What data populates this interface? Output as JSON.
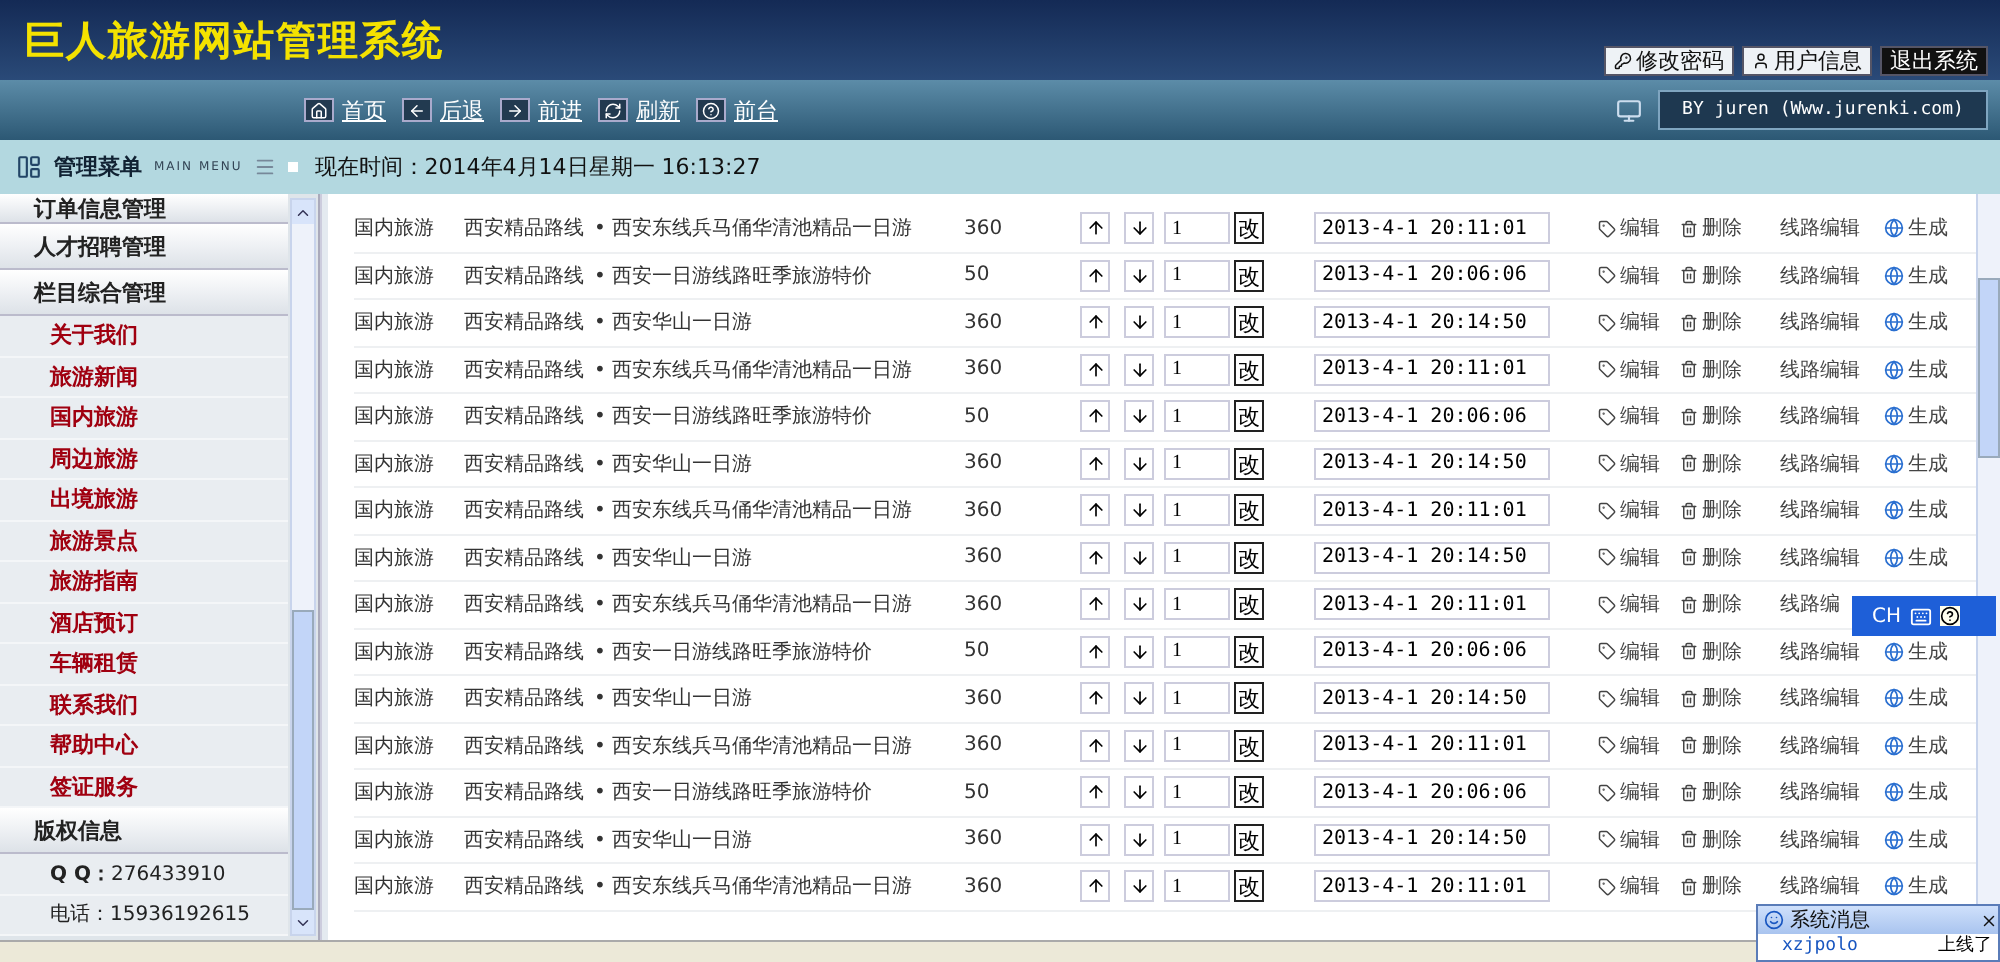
{
  "app_title": "巨人旅游网站管理系统",
  "top_buttons": [
    {
      "label": "修改密码",
      "kind": "key"
    },
    {
      "label": "用户信息",
      "kind": "user"
    },
    {
      "label": "退出系统",
      "kind": "exit"
    }
  ],
  "nav": [
    {
      "label": "首页",
      "kind": "home"
    },
    {
      "label": "后退",
      "kind": "back"
    },
    {
      "label": "前进",
      "kind": "forward"
    },
    {
      "label": "刷新",
      "kind": "refresh"
    },
    {
      "label": "前台",
      "kind": "help"
    }
  ],
  "credit": "BY juren (Www.jurenki.com)",
  "menu_title": "管理菜单",
  "menu_subtitle": "MAIN MENU",
  "clock": "现在时间：2014年4月14日星期一  16:13:27",
  "sidebar": [
    {
      "title": "订单信息管理",
      "kind": "links"
    },
    {
      "title": "人才招聘管理",
      "kind": "links"
    },
    {
      "title": "栏目综合管理",
      "kind": "links",
      "items": [
        "关于我们",
        "旅游新闻",
        "国内旅游",
        "周边旅游",
        "出境旅游",
        "旅游景点",
        "旅游指南",
        "酒店预订",
        "车辆租赁",
        "联系我们",
        "帮助中心",
        "签证服务"
      ]
    },
    {
      "title": "版权信息",
      "kind": "info",
      "items": [
        "**Q Q：**276433910",
        "电话：15936192615"
      ]
    }
  ],
  "rows": [
    {
      "category": "国内旅游",
      "line": "西安精品路线",
      "title": "• 西安东线兵马俑华清池精品一日游",
      "count": "360",
      "order": "1",
      "apply": "改",
      "time": "2013-4-1 20:11:01",
      "edit": "编辑",
      "delete": "删除",
      "route": "线路编辑",
      "generate": "生成"
    },
    {
      "category": "国内旅游",
      "line": "西安精品路线",
      "title": "• 西安一日游线路旺季旅游特价",
      "count": "50",
      "order": "1",
      "apply": "改",
      "time": "2013-4-1 20:06:06",
      "edit": "编辑",
      "delete": "删除",
      "route": "线路编辑",
      "generate": "生成"
    },
    {
      "category": "国内旅游",
      "line": "西安精品路线",
      "title": "• 西安华山一日游",
      "count": "360",
      "order": "1",
      "apply": "改",
      "time": "2013-4-1 20:14:50",
      "edit": "编辑",
      "delete": "删除",
      "route": "线路编辑",
      "generate": "生成"
    },
    {
      "category": "国内旅游",
      "line": "西安精品路线",
      "title": "• 西安东线兵马俑华清池精品一日游",
      "count": "360",
      "order": "1",
      "apply": "改",
      "time": "2013-4-1 20:11:01",
      "edit": "编辑",
      "delete": "删除",
      "route": "线路编辑",
      "generate": "生成"
    },
    {
      "category": "国内旅游",
      "line": "西安精品路线",
      "title": "• 西安一日游线路旺季旅游特价",
      "count": "50",
      "order": "1",
      "apply": "改",
      "time": "2013-4-1 20:06:06",
      "edit": "编辑",
      "delete": "删除",
      "route": "线路编辑",
      "generate": "生成"
    },
    {
      "category": "国内旅游",
      "line": "西安精品路线",
      "title": "• 西安华山一日游",
      "count": "360",
      "order": "1",
      "apply": "改",
      "time": "2013-4-1 20:14:50",
      "edit": "编辑",
      "delete": "删除",
      "route": "线路编辑",
      "generate": "生成"
    },
    {
      "category": "国内旅游",
      "line": "西安精品路线",
      "title": "• 西安东线兵马俑华清池精品一日游",
      "count": "360",
      "order": "1",
      "apply": "改",
      "time": "2013-4-1 20:11:01",
      "edit": "编辑",
      "delete": "删除",
      "route": "线路编辑",
      "generate": "生成"
    },
    {
      "category": "国内旅游",
      "line": "西安精品路线",
      "title": "• 西安华山一日游",
      "count": "360",
      "order": "1",
      "apply": "改",
      "time": "2013-4-1 20:14:50",
      "edit": "编辑",
      "delete": "删除",
      "route": "线路编辑",
      "generate": "生成"
    },
    {
      "category": "国内旅游",
      "line": "西安精品路线",
      "title": "• 西安东线兵马俑华清池精品一日游",
      "count": "360",
      "order": "1",
      "apply": "改",
      "time": "2013-4-1 20:11:01",
      "edit": "编辑",
      "delete": "删除",
      "route": "线路编"
    },
    {
      "category": "国内旅游",
      "line": "西安精品路线",
      "title": "• 西安一日游线路旺季旅游特价",
      "count": "50",
      "order": "1",
      "apply": "改",
      "time": "2013-4-1 20:06:06",
      "edit": "编辑",
      "delete": "删除",
      "route": "线路编辑",
      "generate": "生成"
    },
    {
      "category": "国内旅游",
      "line": "西安精品路线",
      "title": "• 西安华山一日游",
      "count": "360",
      "order": "1",
      "apply": "改",
      "time": "2013-4-1 20:14:50",
      "edit": "编辑",
      "delete": "删除",
      "route": "线路编辑",
      "generate": "生成"
    },
    {
      "category": "国内旅游",
      "line": "西安精品路线",
      "title": "• 西安东线兵马俑华清池精品一日游",
      "count": "360",
      "order": "1",
      "apply": "改",
      "time": "2013-4-1 20:11:01",
      "edit": "编辑",
      "delete": "删除",
      "route": "线路编辑",
      "generate": "生成"
    },
    {
      "category": "国内旅游",
      "line": "西安精品路线",
      "title": "• 西安一日游线路旺季旅游特价",
      "count": "50",
      "order": "1",
      "apply": "改",
      "time": "2013-4-1 20:06:06",
      "edit": "编辑",
      "delete": "删除",
      "route": "线路编辑",
      "generate": "生成"
    },
    {
      "category": "国内旅游",
      "line": "西安精品路线",
      "title": "• 西安华山一日游",
      "count": "360",
      "order": "1",
      "apply": "改",
      "time": "2013-4-1 20:14:50",
      "edit": "编辑",
      "delete": "删除",
      "route": "线路编辑",
      "generate": "生成"
    },
    {
      "category": "国内旅游",
      "line": "西安精品路线",
      "title": "• 西安东线兵马俑华清池精品一日游",
      "count": "360",
      "order": "1",
      "apply": "改",
      "time": "2013-4-1 20:11:01",
      "edit": "编辑",
      "delete": "删除",
      "route": "线路编辑",
      "generate": "生成"
    }
  ],
  "ime": {
    "label": "CH"
  },
  "message": {
    "title": "系统消息",
    "user": "xzjpolo",
    "text": "上线了"
  }
}
